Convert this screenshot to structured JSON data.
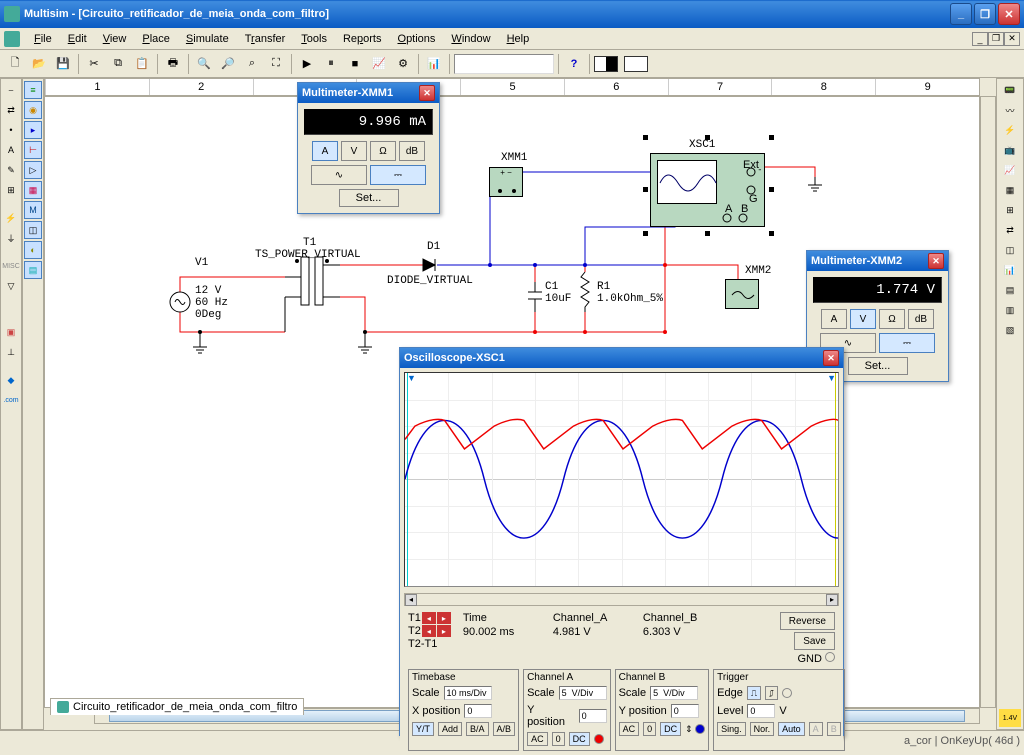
{
  "app": {
    "title": "Multisim - [Circuito_retificador_de_meia_onda_com_filtro]"
  },
  "menu": {
    "file": "File",
    "edit": "Edit",
    "view": "View",
    "place": "Place",
    "simulate": "Simulate",
    "transfer": "Transfer",
    "tools": "Tools",
    "reports": "Reports",
    "options": "Options",
    "window": "Window",
    "help": "Help"
  },
  "ruler": [
    "1",
    "2",
    "3",
    "4",
    "5",
    "6",
    "7",
    "8",
    "9"
  ],
  "tab": {
    "label": "Circuito_retificador_de_meia_onda_com_filtro"
  },
  "status": {
    "right": "a_cor | OnKeyUp( 46d )"
  },
  "circuit": {
    "v1": {
      "ref": "V1",
      "val1": "12 V",
      "val2": "60 Hz",
      "val3": "0Deg"
    },
    "t1": {
      "ref": "T1",
      "val": "TS_POWER_VIRTUAL"
    },
    "d1": {
      "ref": "D1",
      "val": "DIODE_VIRTUAL"
    },
    "c1": {
      "ref": "C1",
      "val": "10uF"
    },
    "r1": {
      "ref": "R1",
      "val": "1.0kOhm_5%"
    },
    "xmm1": "XMM1",
    "xmm2": "XMM2",
    "xsc1": "XSC1"
  },
  "mm1": {
    "title": "Multimeter-XMM1",
    "value": "9.996 mA",
    "btns": {
      "A": "A",
      "V": "V",
      "Ohm": "Ω",
      "dB": "dB",
      "sine": "∿",
      "dc": "⎓"
    },
    "set": "Set..."
  },
  "mm2": {
    "title": "Multimeter-XMM2",
    "value": "1.774 V",
    "btns": {
      "A": "A",
      "V": "V",
      "Ohm": "Ω",
      "dB": "dB",
      "sine": "∿",
      "dc": "⎓"
    },
    "set": "Set..."
  },
  "osc": {
    "title": "Oscilloscope-XSC1",
    "cursors": {
      "time_label": "Time",
      "chA_label": "Channel_A",
      "chB_label": "Channel_B",
      "t1": "T1",
      "t2": "T2",
      "t2t1": "T2-T1",
      "time_val": "90.002 ms",
      "chA_val": "4.981 V",
      "chB_val": "6.303 V"
    },
    "buttons": {
      "reverse": "Reverse",
      "save": "Save",
      "gnd": "GND"
    },
    "timebase": {
      "title": "Timebase",
      "scale_label": "Scale",
      "scale_val": "10 ms/Div",
      "xpos_label": "X position",
      "xpos_val": "0",
      "yt": "Y/T",
      "add": "Add",
      "ba": "B/A",
      "ab": "A/B"
    },
    "chA": {
      "title": "Channel A",
      "scale_label": "Scale",
      "scale_val": "5  V/Div",
      "ypos_label": "Y position",
      "ypos_val": "0",
      "ac": "AC",
      "zero": "0",
      "dc": "DC"
    },
    "chB": {
      "title": "Channel B",
      "scale_label": "Scale",
      "scale_val": "5  V/Div",
      "ypos_label": "Y position",
      "ypos_val": "0",
      "ac": "AC",
      "zero": "0",
      "dc": "DC"
    },
    "trigger": {
      "title": "Trigger",
      "edge_label": "Edge",
      "level_label": "Level",
      "level_val": "0",
      "level_unit": "V",
      "sing": "Sing.",
      "nor": "Nor.",
      "auto": "Auto",
      "a": "A",
      "b": "B"
    }
  }
}
